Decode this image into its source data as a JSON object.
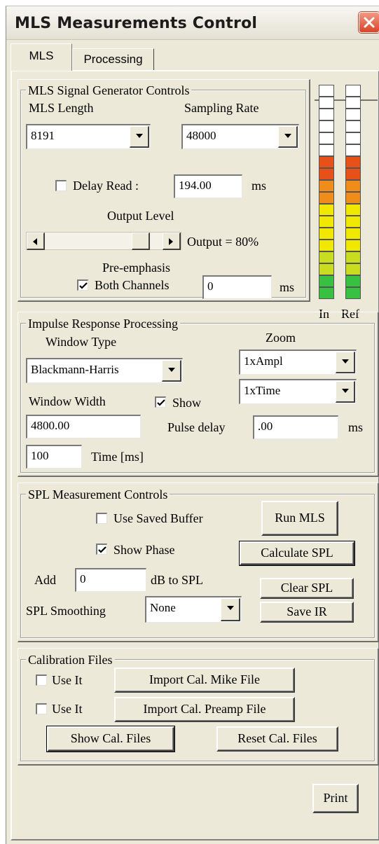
{
  "window": {
    "title": "MLS Measurements Control"
  },
  "tabs": [
    {
      "label": "MLS"
    },
    {
      "label": "Processing"
    }
  ],
  "generator": {
    "legend": "MLS Signal Generator Controls",
    "mls_length_label": "MLS Length",
    "mls_length_value": "8191",
    "sampling_rate_label": "Sampling Rate",
    "sampling_rate_value": "48000",
    "delay_read_label": "Delay Read :",
    "delay_read_checked": false,
    "delay_read_value": "194.00",
    "delay_read_unit": "ms",
    "output_level_label": "Output Level",
    "output_level_fraction": 0.8,
    "output_text": "Output = 80%",
    "preemphasis_label": "Pre-emphasis",
    "both_channels_label": "Both Channels",
    "both_channels_checked": true,
    "preemphasis_value": "0",
    "preemphasis_unit": "ms"
  },
  "meters": {
    "in_label": "In",
    "ref_label": "Ref"
  },
  "impulse": {
    "legend": "Impulse Response Processing",
    "window_type_label": "Window Type",
    "window_type_value": "Blackmann-Harris",
    "zoom_label": "Zoom",
    "zoom_ampl_value": "1xAmpl",
    "zoom_time_value": "1xTime",
    "window_width_label": "Window Width",
    "show_label": "Show",
    "show_checked": true,
    "window_width_value": "4800.00",
    "pulse_delay_label": "Pulse delay",
    "pulse_delay_value": ".00",
    "pulse_delay_unit": "ms",
    "time_value": "100",
    "time_label": "Time [ms]"
  },
  "spl": {
    "legend": "SPL Measurement Controls",
    "use_saved_buffer_label": "Use Saved Buffer",
    "use_saved_buffer_checked": false,
    "run_mls_label": "Run MLS",
    "show_phase_label": "Show Phase",
    "show_phase_checked": true,
    "calculate_spl_label": "Calculate SPL",
    "add_label": "Add",
    "add_value": "0",
    "db_to_spl_label": "dB to SPL",
    "clear_spl_label": "Clear SPL",
    "smoothing_label": "SPL Smoothing",
    "smoothing_value": "None",
    "save_ir_label": "Save IR"
  },
  "calibration": {
    "legend": "Calibration Files",
    "use_it_label_1": "Use It",
    "use_it_checked_1": false,
    "import_mike_label": "Import Cal. Mike File",
    "use_it_label_2": "Use It",
    "use_it_checked_2": false,
    "import_preamp_label": "Import Cal. Preamp File",
    "show_cal_files_label": "Show Cal. Files",
    "reset_cal_files_label": "Reset Cal. Files"
  },
  "footer": {
    "print_label": "Print"
  },
  "colors": {
    "panel": "#ece9d8",
    "meter_unlit": "#ffffff",
    "meter_red": "#e8501a",
    "meter_orange": "#f08c1a",
    "meter_yellow": "#f0e800",
    "meter_yellowgreen": "#c8dc20",
    "meter_green": "#38c040"
  }
}
